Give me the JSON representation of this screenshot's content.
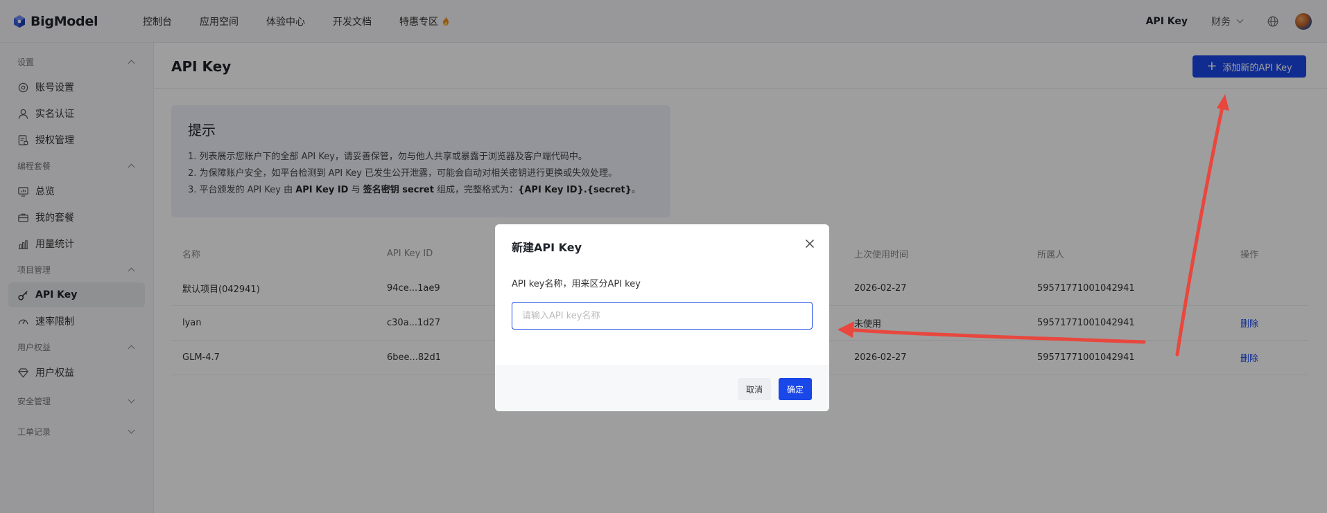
{
  "brand": {
    "name": "BigModel",
    "color": "#1a47e8"
  },
  "topnav": {
    "items": [
      "控制台",
      "应用空间",
      "体验中心",
      "开发文档",
      "特惠专区"
    ],
    "hot_icon": "fire-icon",
    "apikey": "API Key",
    "finance": "财务"
  },
  "sidebar": {
    "sections": [
      {
        "title": "设置",
        "expanded": true,
        "items": [
          "账号设置",
          "实名认证",
          "授权管理"
        ]
      },
      {
        "title": "编程套餐",
        "expanded": true,
        "items": [
          "总览",
          "我的套餐",
          "用量统计"
        ]
      },
      {
        "title": "项目管理",
        "expanded": true,
        "items": [
          "API Key",
          "速率限制"
        ]
      },
      {
        "title": "用户权益",
        "expanded": true,
        "items": [
          "用户权益"
        ]
      },
      {
        "title": "安全管理",
        "expanded": false,
        "items": []
      },
      {
        "title": "工单记录",
        "expanded": false,
        "items": []
      }
    ],
    "active": "API Key"
  },
  "page": {
    "title": "API Key",
    "add_button": "添加新的API Key"
  },
  "tips": {
    "title": "提示",
    "line1": "1. 列表展示您账户下的全部 API Key，请妥善保管，勿与他人共享或暴露于浏览器及客户端代码中。",
    "line2": "2. 为保障账户安全，如平台检测到 API Key 已发生公开泄露，可能会自动对相关密钥进行更换或失效处理。",
    "line3_a": "3. 平台颁发的 API Key 由 ",
    "line3_b": "API Key ID",
    "line3_c": " 与 ",
    "line3_d": "签名密钥 secret",
    "line3_e": " 组成，完整格式为：",
    "line3_f": "{API Key ID}.{secret}",
    "line3_g": "。"
  },
  "table": {
    "headers": [
      "名称",
      "API Key ID",
      "",
      "上次使用时间",
      "所属人",
      "操作"
    ],
    "rows": [
      {
        "name": "默认项目(042941)",
        "id": "94ce...1ae9",
        "last_used": "2026-02-27",
        "owner": "59571771001042941",
        "action": ""
      },
      {
        "name": "lyan",
        "id": "c30a...1d27",
        "last_used": "未使用",
        "owner": "59571771001042941",
        "action": "删除"
      },
      {
        "name": "GLM-4.7",
        "id": "6bee...82d1",
        "last_used": "2026-02-27",
        "owner": "59571771001042941",
        "action": "删除"
      }
    ]
  },
  "modal": {
    "title": "新建API Key",
    "label": "API key名称，用来区分API key",
    "input_placeholder": "请输入API key名称",
    "input_value": "",
    "cancel": "取消",
    "confirm": "确定"
  },
  "annotation": {
    "arrow_color": "#e8473e"
  }
}
